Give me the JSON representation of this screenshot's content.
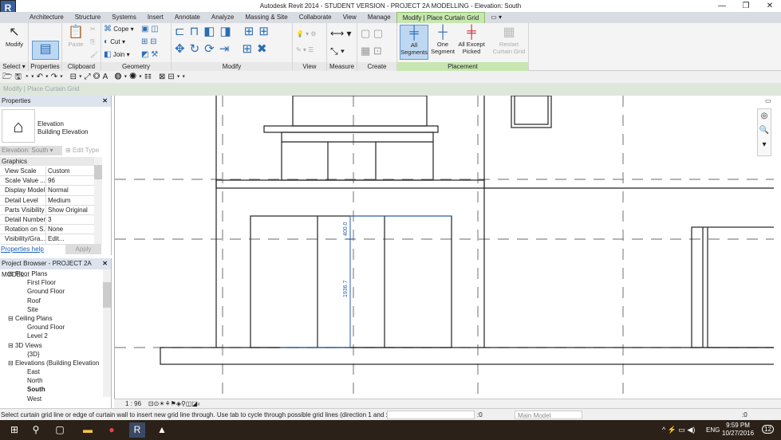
{
  "window": {
    "title": "Autodesk Revit 2014 - STUDENT VERSION -    PROJECT 2A MODELLING - Elevation: South",
    "app_button": "R",
    "minimize": "—",
    "maximize": "❐",
    "close": "✕"
  },
  "tabs": [
    "Architecture",
    "Structure",
    "Systems",
    "Insert",
    "Annotate",
    "Analyze",
    "Massing & Site",
    "Collaborate",
    "View",
    "Manage",
    "Modify | Place Curtain Grid",
    "▭ ▾"
  ],
  "ribbon": {
    "select": {
      "modify": "Modify",
      "label": "Select ▾"
    },
    "properties": {
      "label": "Properties"
    },
    "clipboard": {
      "paste": "Paste",
      "label": "Clipboard"
    },
    "geometry": {
      "cope": "Cope",
      "cut": "Cut",
      "join": "Join",
      "label": "Geometry"
    },
    "modify": {
      "label": "Modify"
    },
    "view": {
      "label": "View"
    },
    "measure": {
      "label": "Measure"
    },
    "create": {
      "label": "Create"
    },
    "placement": {
      "all_segments": "All Segments",
      "one_segment": "One Segment",
      "all_except": "All Except Picked",
      "restart": "Restart Curtain Grid",
      "label": "Placement"
    }
  },
  "context_bar": "Modify | Place Curtain Grid",
  "properties": {
    "title": "Properties",
    "type_name": "Elevation",
    "type_sub": "Building Elevation",
    "selector": "Elevation: South",
    "edit_type": "Edit Type",
    "section": "Graphics",
    "rows": [
      [
        "View Scale",
        "Custom"
      ],
      [
        "Scale Value  ...",
        "96"
      ],
      [
        "Display Model",
        "Normal"
      ],
      [
        "Detail Level",
        "Medium"
      ],
      [
        "Parts Visibility",
        "Show Original"
      ],
      [
        "Detail Number",
        "3"
      ],
      [
        "Rotation on S...",
        "None"
      ],
      [
        "Visibility/Gra...",
        "Edit..."
      ]
    ],
    "help": "Properties help",
    "apply": "Apply"
  },
  "browser": {
    "title": "Project Browser - PROJECT 2A MODEL...",
    "items": [
      {
        "t": "Floor Plans",
        "l": 1
      },
      {
        "t": "First Floor",
        "l": 2
      },
      {
        "t": "Ground Floor",
        "l": 2
      },
      {
        "t": "Roof",
        "l": 2
      },
      {
        "t": "Site",
        "l": 2
      },
      {
        "t": "Ceiling Plans",
        "l": 1
      },
      {
        "t": "Ground Floor",
        "l": 2
      },
      {
        "t": "Level 2",
        "l": 2
      },
      {
        "t": "3D Views",
        "l": 1
      },
      {
        "t": "{3D}",
        "l": 2
      },
      {
        "t": "Elevations (Building Elevation",
        "l": 1
      },
      {
        "t": "East",
        "l": 2
      },
      {
        "t": "North",
        "l": 2
      },
      {
        "t": "South",
        "l": 2,
        "bold": true
      },
      {
        "t": "West",
        "l": 2
      }
    ]
  },
  "canvas": {
    "dim_top": "400.0",
    "dim_bottom": "1936.7"
  },
  "viewbar": {
    "scale": "1 : 96"
  },
  "status": {
    "message": "Select curtain grid line or edge of curtain wall to insert new grid line through.  Use tab to cycle through possible grid lines (direction 1 and :",
    "workset": ":0",
    "model": "Main Model",
    "filter": ":0"
  },
  "taskbar": {
    "lang": "ENG",
    "time": "9:59 PM",
    "date": "10/27/2016",
    "notif": "12"
  },
  "colors": {
    "accent": "#c7e6b0",
    "dimension": "#2a5db0"
  }
}
